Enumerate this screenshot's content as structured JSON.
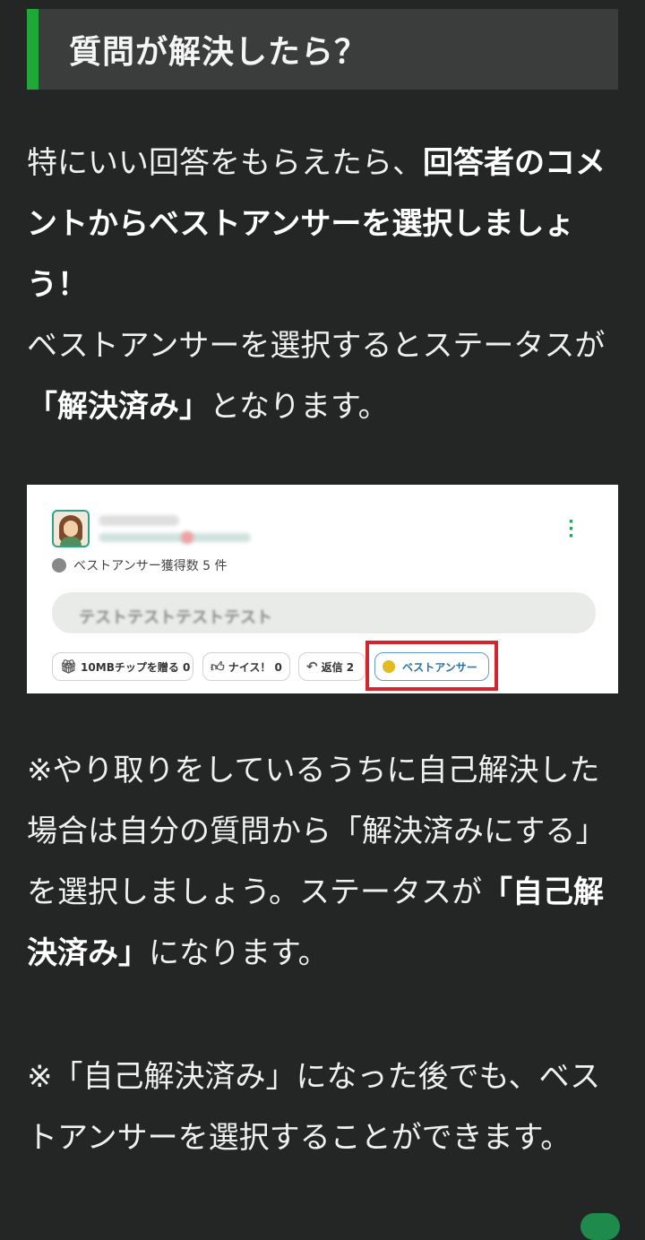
{
  "heading": "質問が解決したら？",
  "para1": {
    "text_a": "特にいい回答をもらえたら、",
    "bold_a": "回答者のコメントからベストアンサーを選択しましょう！",
    "text_b": "ベストアンサーを選択するとステータスが",
    "bold_b": "「解決済み」",
    "text_c": "となります。"
  },
  "screenshot": {
    "best_answer_count": "ベストアンサー獲得数 5 件",
    "comment_text": "テストテストテストテスト",
    "buttons": {
      "tip": "10MBチップを贈る 0",
      "nice": "ナイス！ 0",
      "reply": "返信 2",
      "best_answer": "ベストアンサー"
    },
    "icons": {
      "tip": "gift-icon",
      "nice": "thumbs-up-icon",
      "reply": "reply-icon",
      "best": "gold-coin-icon",
      "menu": "kebab-menu-icon"
    }
  },
  "para2": {
    "text_a": "※やり取りをしているうちに自己解決した場合は自分の質問から「解決済みにする」を選択しましょう。ステータスが",
    "bold_a": "「自己解決済み」",
    "text_b": "になります。"
  },
  "para3": {
    "text": "※「自己解決済み」になった後でも、ベストアンサーを選択することができます。"
  },
  "colors": {
    "background": "#232625",
    "heading_bg": "#3a3d3b",
    "accent": "#1fa838",
    "highlight_box": "#d4242c"
  }
}
